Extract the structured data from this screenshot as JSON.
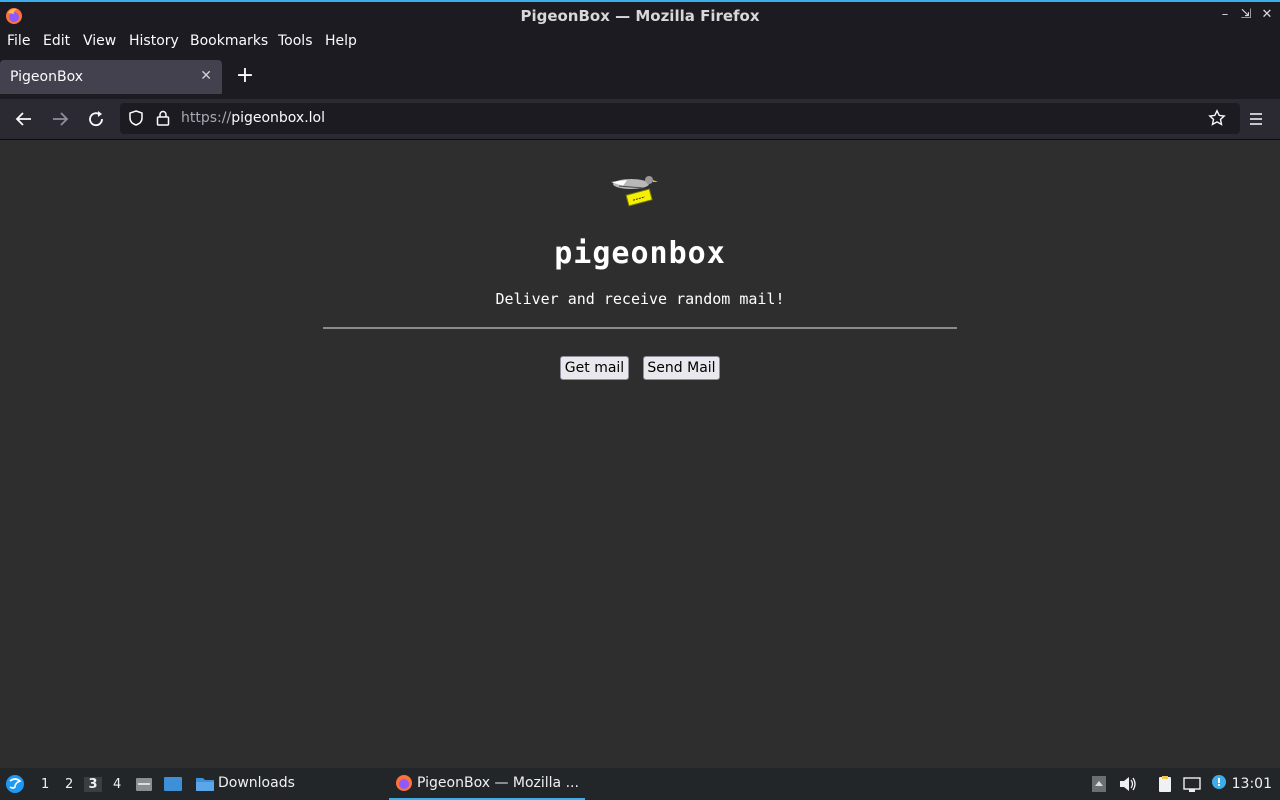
{
  "window": {
    "title": "PigeonBox — Mozilla Firefox",
    "accent": "#3daee9"
  },
  "menubar": {
    "items": [
      "File",
      "Edit",
      "View",
      "History",
      "Bookmarks",
      "Tools",
      "Help"
    ]
  },
  "tabs": [
    {
      "label": "PigeonBox",
      "active": true
    }
  ],
  "navbar": {
    "url_scheme": "https://",
    "url_host": "pigeonbox.lol"
  },
  "page": {
    "title": "pigeonbox",
    "tagline": "Deliver and receive random mail!",
    "buttons": {
      "get_mail": "Get mail",
      "send_mail": "Send Mail"
    }
  },
  "taskbar": {
    "workspaces": [
      "1",
      "2",
      "3",
      "4"
    ],
    "active_workspace": "3",
    "downloads_label": "Downloads",
    "active_task": "PigeonBox — Mozilla ...",
    "clock": "13:01"
  }
}
